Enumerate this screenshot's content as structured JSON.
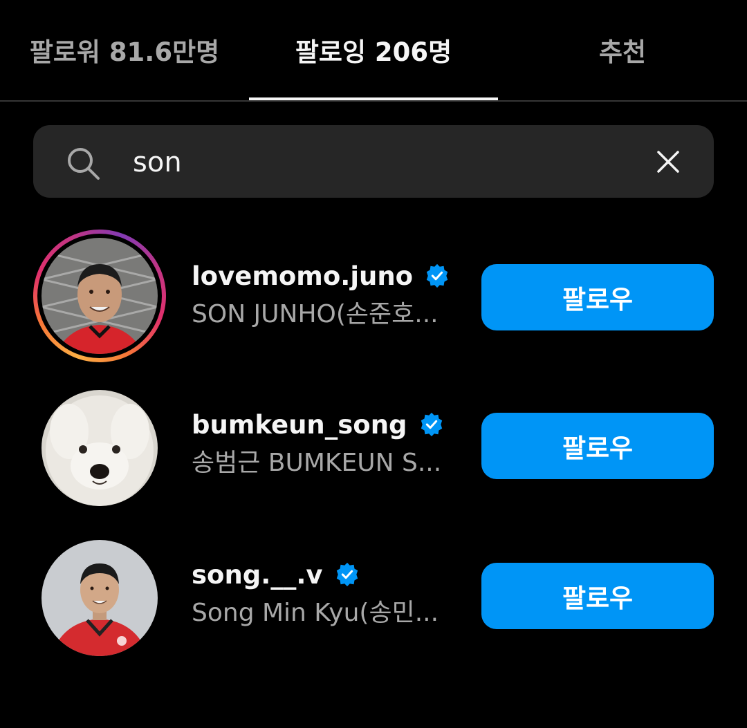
{
  "tabs": [
    {
      "label": "팔로워 81.6만명",
      "active": false
    },
    {
      "label": "팔로잉 206명",
      "active": true
    },
    {
      "label": "추천",
      "active": false
    }
  ],
  "search": {
    "value": "son",
    "icon": "search-icon",
    "clear_icon": "close-icon"
  },
  "results": [
    {
      "username": "lovemomo.juno",
      "full_name": "SON JUNHO(손준호...",
      "verified": true,
      "has_story": true,
      "button_label": "팔로우"
    },
    {
      "username": "bumkeun_song",
      "full_name": "송범근 BUMKEUN S...",
      "verified": true,
      "has_story": false,
      "button_label": "팔로우"
    },
    {
      "username": "song.__.v",
      "full_name": "Song Min Kyu(송민...",
      "verified": true,
      "has_story": false,
      "button_label": "팔로우"
    }
  ],
  "colors": {
    "background": "#000000",
    "accent_blue": "#0095f6",
    "search_bg": "#262626",
    "secondary_text": "#a8a8a8"
  }
}
